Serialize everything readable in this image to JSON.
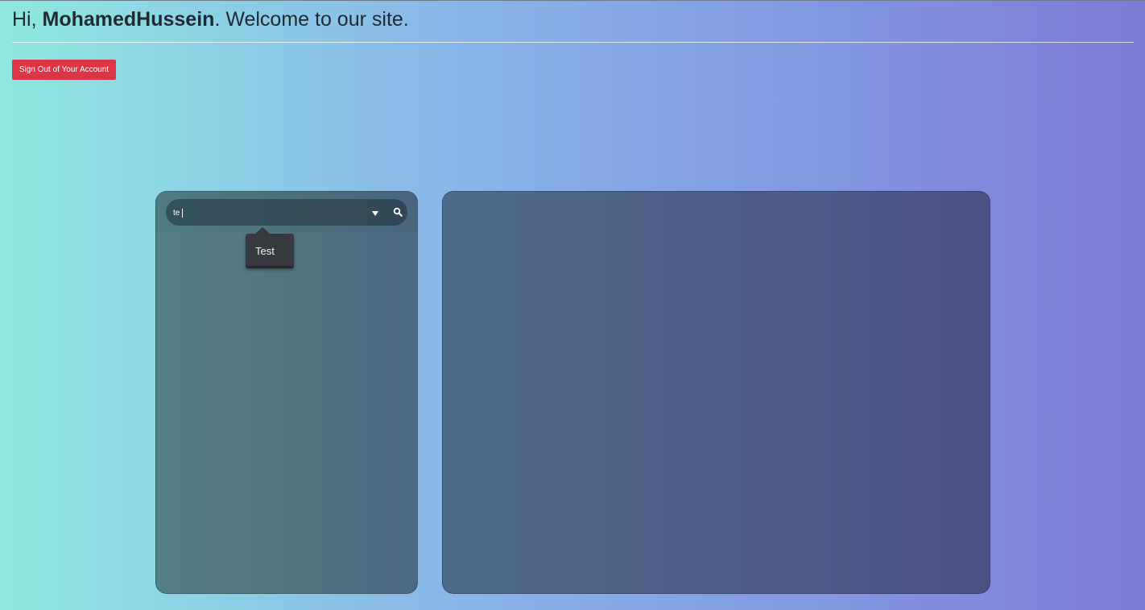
{
  "header": {
    "greeting_prefix": "Hi, ",
    "username": "MohamedHussein",
    "greeting_suffix": ". Welcome to our site."
  },
  "account": {
    "signout_label": "Sign Out of Your Account"
  },
  "search": {
    "value": "te",
    "dropdown_icon": "triangle-down",
    "search_icon": "magnifier",
    "suggestions": [
      "Test"
    ]
  },
  "colors": {
    "signout_button": "#dc3545",
    "background_start": "#8fe8e0",
    "background_end": "#7e7bd6"
  }
}
